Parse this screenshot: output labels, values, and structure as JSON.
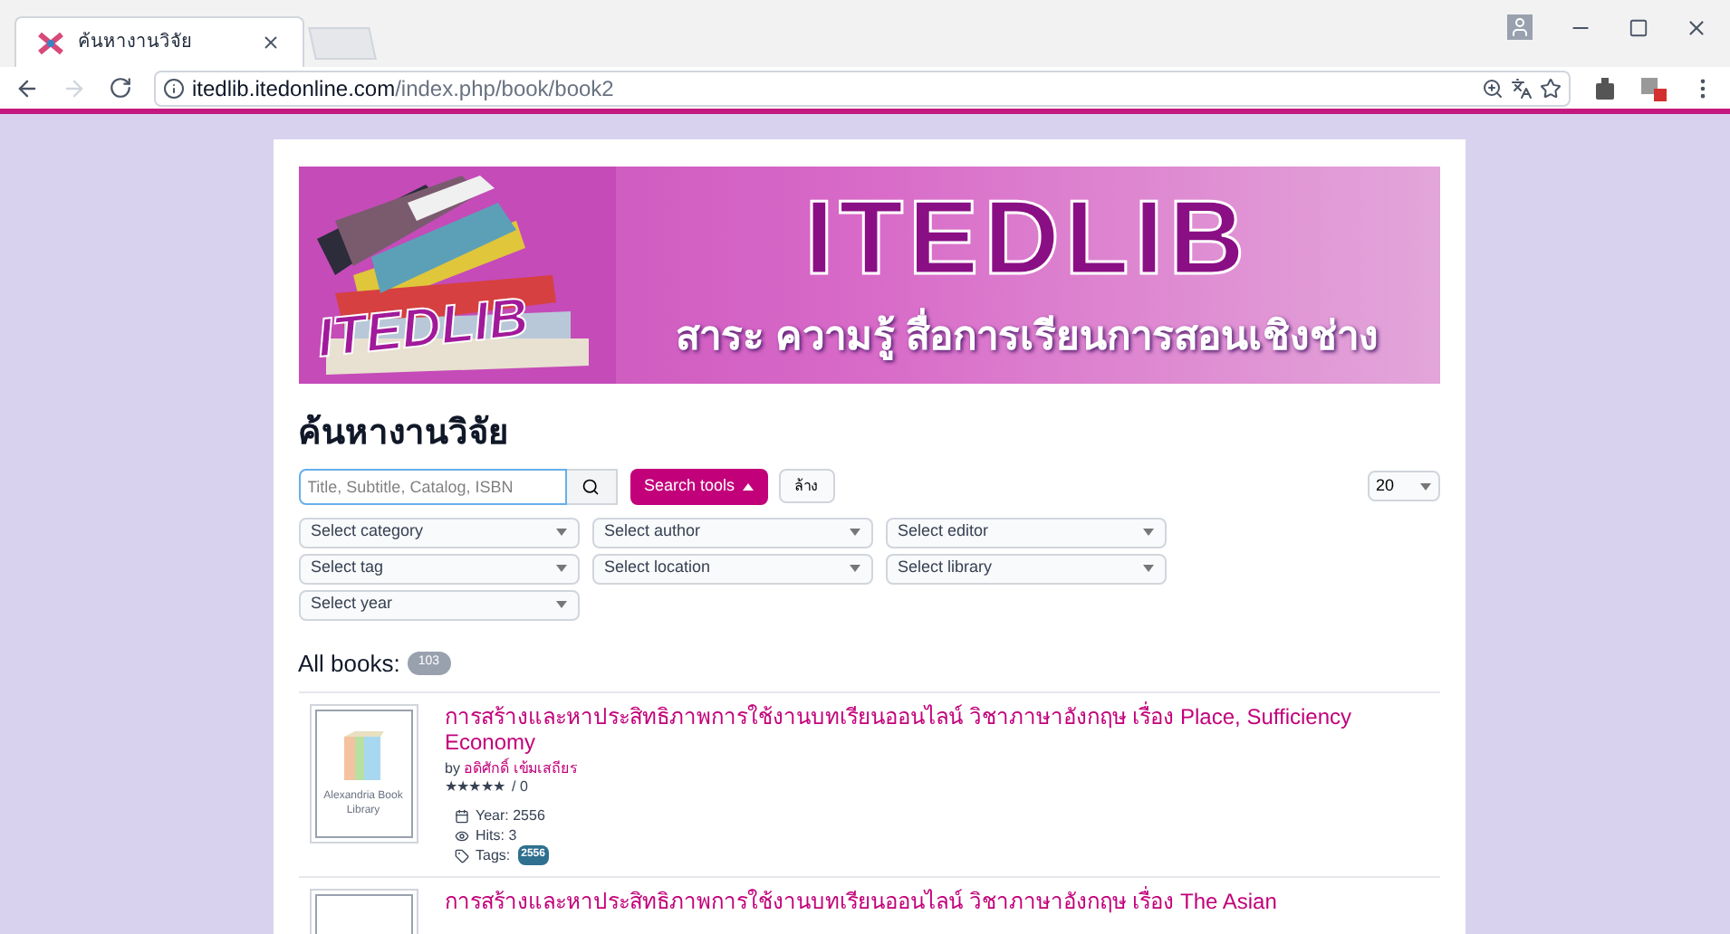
{
  "browser": {
    "tabs": [
      {
        "title": "ค้นหางานวิจัย",
        "selected": true
      }
    ],
    "url_host": "itedlib.itedonline.com",
    "url_path": "/index.php/book/book2"
  },
  "banner": {
    "logo_text": "ITEDLIB",
    "title": "ITEDLIB",
    "subtitle": "สาระ ความรู้ สื่อการเรียนการสอนเชิงช่าง"
  },
  "heading": "ค้นหางานวิจัย",
  "search": {
    "placeholder": "Title, Subtitle, Catalog, ISBN",
    "tools_button": "Search tools",
    "clear_button": "ล้าง",
    "page_size": "20"
  },
  "filters": [
    "Select category",
    "Select author",
    "Select editor",
    "Select tag",
    "Select location",
    "Select library",
    "Select year"
  ],
  "all_books": {
    "label": "All books:",
    "count": "103"
  },
  "books": [
    {
      "title": "การสร้างและหาประสิทธิภาพการใช้งานบทเรียนออนไลน์ วิชาภาษาอังกฤษ เรื่อง Place, Sufficiency Economy",
      "by": "by",
      "author": "อดิศักดิ์ เข้มเสถียร",
      "stars": "★★★★★",
      "rating": "/ 0",
      "cover_text": "Alexandria Book Library",
      "year": "Year: 2556",
      "hits": "Hits: 3",
      "tags_label": "Tags:",
      "tags": [
        "2556"
      ]
    },
    {
      "title": "การสร้างและหาประสิทธิภาพการใช้งานบทเรียนออนไลน์ วิชาภาษาอังกฤษ เรื่อง The Asian"
    }
  ]
}
